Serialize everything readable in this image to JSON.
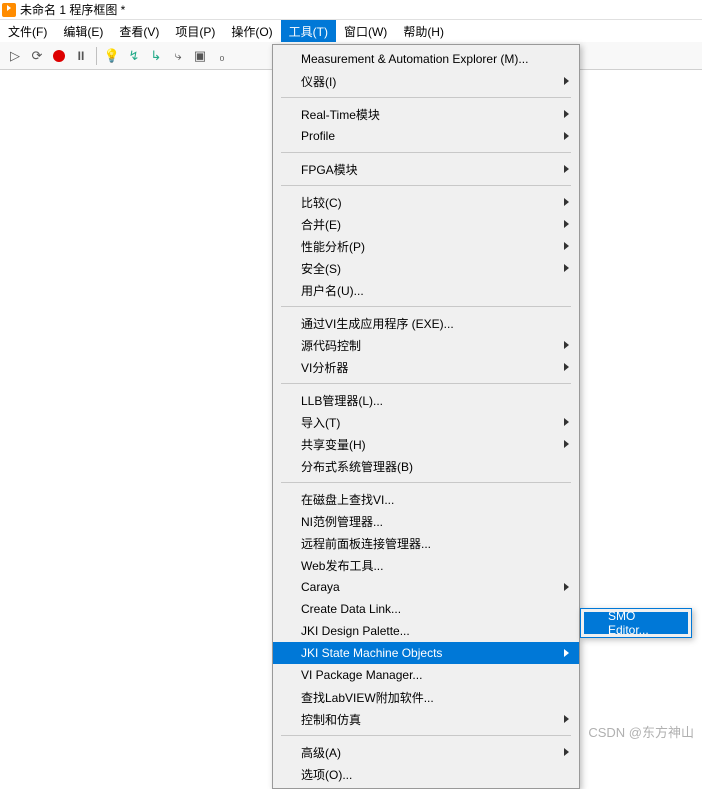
{
  "title": "未命名 1 程序框图 *",
  "menubar": [
    "文件(F)",
    "编辑(E)",
    "查看(V)",
    "项目(P)",
    "操作(O)",
    "工具(T)",
    "窗口(W)",
    "帮助(H)"
  ],
  "menubar_selected_index": 5,
  "toolbar_icons": [
    "run-icon",
    "run-continuously-icon",
    "abort-icon",
    "pause-icon",
    "highlight-icon",
    "retain-icon",
    "step-into-icon",
    "step-over-icon",
    "step-out-icon"
  ],
  "dropdown": {
    "groups": [
      [
        {
          "label": "Measurement & Automation Explorer (M)...",
          "arrow": false
        },
        {
          "label": "仪器(I)",
          "arrow": true
        }
      ],
      [
        {
          "label": "Real-Time模块",
          "arrow": true
        },
        {
          "label": "Profile",
          "arrow": true
        }
      ],
      [
        {
          "label": "FPGA模块",
          "arrow": true
        }
      ],
      [
        {
          "label": "比较(C)",
          "arrow": true
        },
        {
          "label": "合并(E)",
          "arrow": true
        },
        {
          "label": "性能分析(P)",
          "arrow": true
        },
        {
          "label": "安全(S)",
          "arrow": true
        },
        {
          "label": "用户名(U)...",
          "arrow": false
        }
      ],
      [
        {
          "label": "通过VI生成应用程序 (EXE)...",
          "arrow": false
        },
        {
          "label": "源代码控制",
          "arrow": true
        },
        {
          "label": "VI分析器",
          "arrow": true
        }
      ],
      [
        {
          "label": "LLB管理器(L)...",
          "arrow": false
        },
        {
          "label": "导入(T)",
          "arrow": true
        },
        {
          "label": "共享变量(H)",
          "arrow": true
        },
        {
          "label": "分布式系统管理器(B)",
          "arrow": false
        }
      ],
      [
        {
          "label": "在磁盘上查找VI...",
          "arrow": false
        },
        {
          "label": "NI范例管理器...",
          "arrow": false
        },
        {
          "label": "远程前面板连接管理器...",
          "arrow": false
        },
        {
          "label": "Web发布工具...",
          "arrow": false
        },
        {
          "label": "Caraya",
          "arrow": true
        },
        {
          "label": "Create Data Link...",
          "arrow": false
        },
        {
          "label": "JKI Design Palette...",
          "arrow": false
        },
        {
          "label": "JKI State Machine Objects",
          "arrow": true,
          "highlighted": true
        },
        {
          "label": "VI Package Manager...",
          "arrow": false
        },
        {
          "label": "查找LabVIEW附加软件...",
          "arrow": false
        },
        {
          "label": "控制和仿真",
          "arrow": true
        }
      ],
      [
        {
          "label": "高级(A)",
          "arrow": true
        },
        {
          "label": "选项(O)...",
          "arrow": false
        }
      ]
    ]
  },
  "submenu": {
    "label": "SMO Editor..."
  },
  "watermark": "CSDN @东方神山"
}
